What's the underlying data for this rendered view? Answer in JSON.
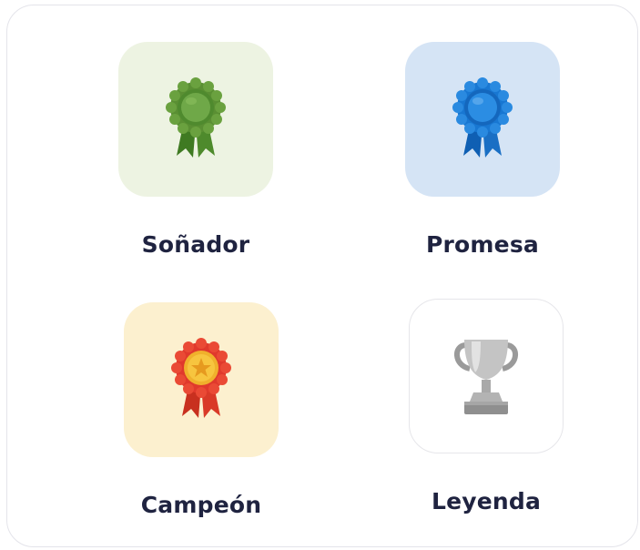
{
  "badges": [
    {
      "name": "Soñador",
      "icon": "green-rosette-icon",
      "tile_color": "#edf3e2",
      "accent": "#5a8f33"
    },
    {
      "name": "Promesa",
      "icon": "blue-rosette-icon",
      "tile_color": "#d5e4f5",
      "accent": "#1877d2"
    },
    {
      "name": "Campeón",
      "icon": "gold-star-medal-icon",
      "tile_color": "#fcf0cf",
      "accent": "#e0392c"
    },
    {
      "name": "Leyenda",
      "icon": "silver-trophy-icon",
      "tile_color": "#ffffff",
      "accent": "#a7a7a7"
    }
  ]
}
